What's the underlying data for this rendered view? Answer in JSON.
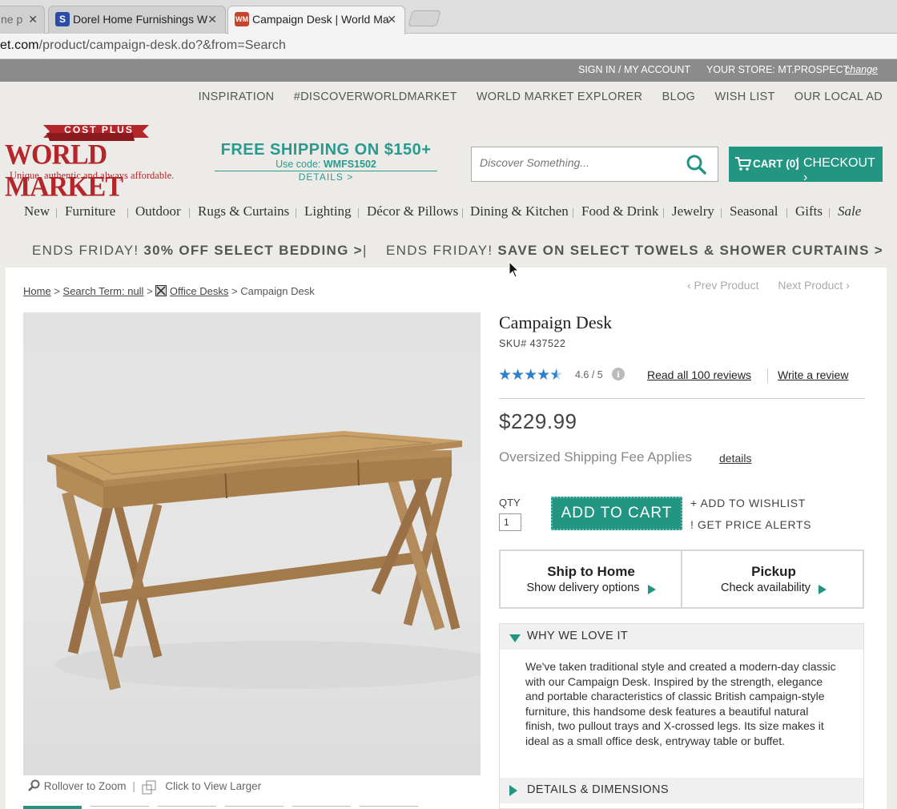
{
  "browser": {
    "tabs": [
      {
        "title": "ne p",
        "favicon": ""
      },
      {
        "title": "Dorel Home Furnishings W",
        "favicon": "S",
        "favicon_color": "#2b4ba8"
      },
      {
        "title": "Campaign Desk | World Ma",
        "favicon": "WM",
        "favicon_color": "#c8432b"
      }
    ],
    "url_host": "et.com",
    "url_path": "/product/campaign-desk.do?&from=Search"
  },
  "account_bar": {
    "sign_in": "SIGN IN / MY ACCOUNT",
    "store_label": "YOUR STORE: MT.PROSPECT",
    "change": "change"
  },
  "top_nav": [
    "INSPIRATION",
    "#DISCOVERWORLDMARKET",
    "WORLD MARKET EXPLORER",
    "BLOG",
    "WISH LIST",
    "OUR LOCAL AD"
  ],
  "logo": {
    "ribbon": "COST PLUS",
    "name": "WORLD MARKET",
    "tagline": "Unique, authentic and always affordable."
  },
  "free_shipping": {
    "headline": "FREE SHIPPING ON $150+",
    "code_label": "Use code: ",
    "code": "WMFS1502",
    "details": "DETAILS >"
  },
  "search": {
    "placeholder": "Discover Something..."
  },
  "cart": {
    "label": "CART (0)",
    "checkout": "CHECKOUT ›"
  },
  "categories": [
    "New",
    "Furniture",
    "Outdoor",
    "Rugs & Curtains",
    "Lighting",
    "Décor & Pillows",
    "Dining & Kitchen",
    "Food & Drink",
    "Jewelry",
    "Seasonal",
    "Gifts",
    "Sale"
  ],
  "promos": [
    {
      "lead": "ENDS FRIDAY! ",
      "bold": "30% OFF SELECT BEDDING >"
    },
    {
      "lead": "ENDS FRIDAY! ",
      "bold": "SAVE ON SELECT TOWELS & SHOWER CURTAINS >"
    }
  ],
  "promo_sep": "|",
  "breadcrumb": {
    "home": "Home",
    "search": "Search Term: null",
    "category": "Office Desks",
    "current": "Campaign Desk",
    "sep": ">"
  },
  "pager": {
    "prev": "‹ Prev Product",
    "next": "Next Product ›"
  },
  "product": {
    "title": "Campaign Desk",
    "sku": "SKU#  437522",
    "rating": 4.6,
    "rating_text": "4.6 / 5",
    "read_reviews": "Read all 100 reviews",
    "write_review": "Write a review",
    "price": "$229.99",
    "shipping_note": "Oversized Shipping Fee Applies",
    "shipping_details": "details",
    "qty_label": "QTY",
    "qty_value": "1",
    "add_to_cart": "ADD TO CART",
    "add_to_wishlist": "+ ADD TO WISHLIST",
    "price_alerts": "! GET PRICE ALERTS"
  },
  "fulfillment": [
    {
      "title": "Ship to Home",
      "subtitle": "Show delivery options"
    },
    {
      "title": "Pickup",
      "subtitle": "Check availability"
    }
  ],
  "accordion": {
    "why_title": "WHY WE LOVE IT",
    "why_body": "We've taken traditional style and created a modern-day classic with our Campaign Desk. Inspired by the strength, elegance and portable characteristics of classic British campaign-style furniture, this handsome desk features a beautiful natural finish, two pullout trays and X-crossed legs. Its size makes it ideal as a small office desk, entryway table or buffet.",
    "details_title": "DETAILS & DIMENSIONS"
  },
  "image_tools": {
    "zoom": "Rollover to Zoom",
    "sep": "|",
    "larger": "Click to View Larger"
  },
  "colors": {
    "teal": "#229583",
    "star": "#2e7fd0",
    "logo_red": "#b5262b"
  }
}
